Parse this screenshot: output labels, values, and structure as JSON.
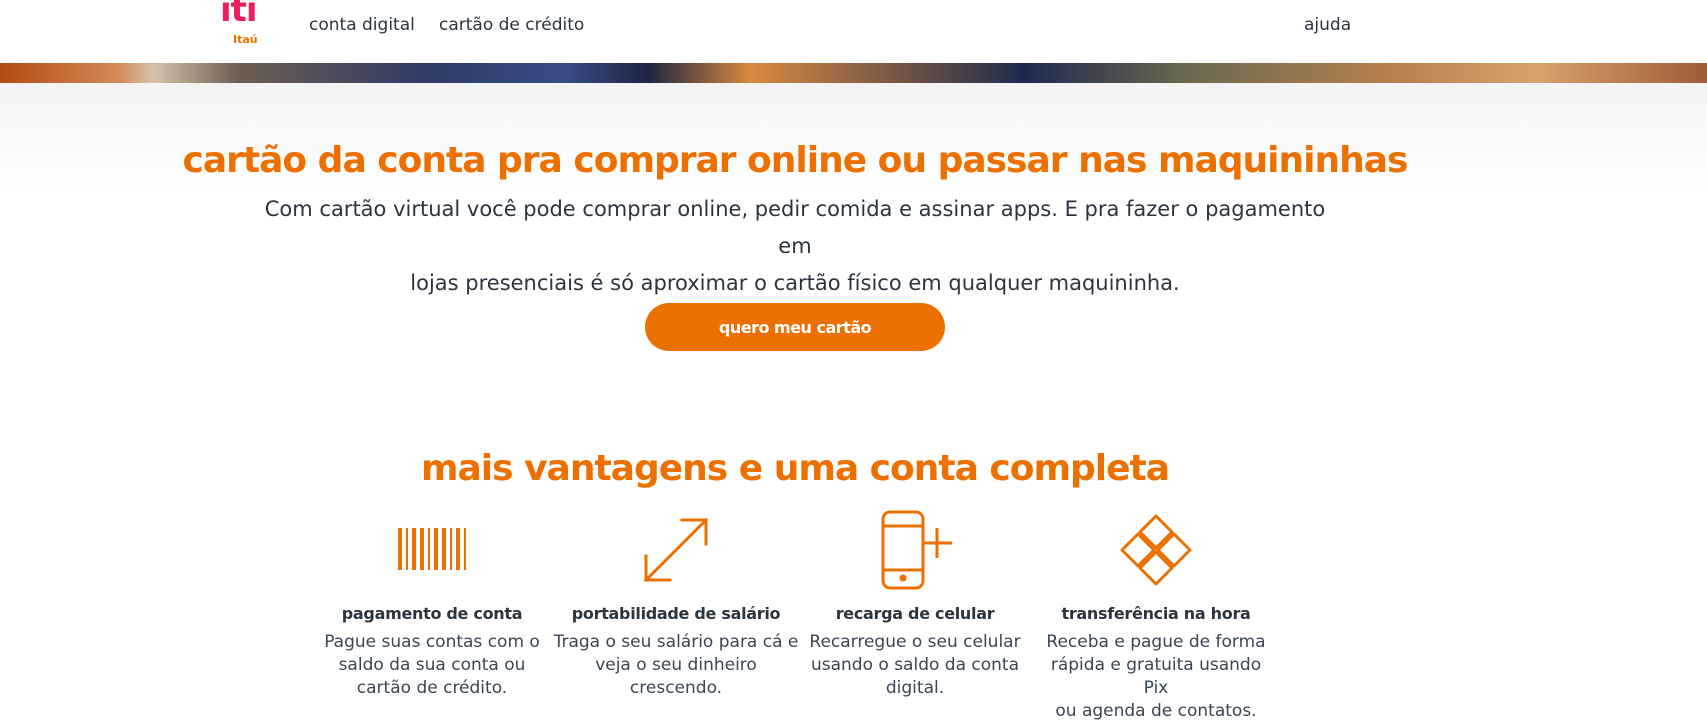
{
  "brand": {
    "logo_main": "iti",
    "logo_sub": "Itaú",
    "accent": "#ec7000",
    "logo_pink": "#ec1e5e"
  },
  "nav": {
    "conta_digital": "conta digital",
    "cartao_credito": "cartão de crédito",
    "ajuda": "ajuda"
  },
  "hero": {
    "title": "cartão da conta pra comprar online ou passar nas maquininhas",
    "description_line1": "Com cartão virtual você pode comprar online, pedir comida e assinar apps. E pra fazer o pagamento em",
    "description_line2": "lojas presenciais é só aproximar o cartão físico em qualquer maquininha.",
    "cta_label": "quero meu cartão"
  },
  "benefits": {
    "title": "mais vantagens e uma conta completa",
    "items": [
      {
        "icon": "barcode-icon",
        "title": "pagamento de conta",
        "text_lines": [
          "Pague suas contas com o",
          "saldo da sua conta ou",
          "cartão de crédito."
        ]
      },
      {
        "icon": "expand-arrows-icon",
        "title": "portabilidade de salário",
        "text_lines": [
          "Traga o seu salário para cá e",
          "veja o seu dinheiro",
          "crescendo."
        ]
      },
      {
        "icon": "phone-plus-icon",
        "title": "recarga de celular",
        "text_lines": [
          "Recarregue o seu celular",
          "usando o saldo da conta",
          "digital."
        ]
      },
      {
        "icon": "pix-icon",
        "title": "transferência na hora",
        "text_lines": [
          "Receba e pague de forma",
          "rápida e gratuita usando Pix",
          "ou agenda de contatos."
        ]
      }
    ]
  }
}
